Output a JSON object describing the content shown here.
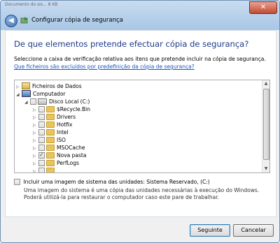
{
  "window": {
    "corner_text": "Documento do sis... 8 KB",
    "title": "Configurar cópia de segurança",
    "close_label": "✕"
  },
  "heading": "De que elementos pretende efectuar cópia de segurança?",
  "instructions": {
    "text": "Seleccione a caixa de verificação relativa aos itens que pretende incluir na cópia de segurança.",
    "link": "Que ficheiros são excluídos por predefinição da cópia de segurança?"
  },
  "tree": {
    "items": [
      {
        "label": "Ficheiros de Dados",
        "icon": "library-icon",
        "checked": false,
        "expander": "▷"
      },
      {
        "label": "Computador",
        "icon": "computer-icon",
        "checked": false,
        "expander": "◢"
      },
      {
        "label": "Disco Local (C:)",
        "icon": "drive-icon",
        "checked": false,
        "expander": "◢"
      },
      {
        "label": "$Recycle.Bin",
        "icon": "folder-icon",
        "checked": false,
        "expander": "▷"
      },
      {
        "label": "Drivers",
        "icon": "folder-icon",
        "checked": false,
        "expander": "▷"
      },
      {
        "label": "Hotfix",
        "icon": "folder-icon",
        "checked": false,
        "expander": "▷"
      },
      {
        "label": "Intel",
        "icon": "folder-icon",
        "checked": false,
        "expander": "▷"
      },
      {
        "label": "ISO",
        "icon": "folder-icon",
        "checked": false,
        "expander": "▷"
      },
      {
        "label": "MSOCache",
        "icon": "folder-icon",
        "checked": false,
        "expander": "▷"
      },
      {
        "label": "Nova pasta",
        "icon": "folder-icon",
        "checked": true,
        "expander": "▷"
      },
      {
        "label": "PerfLogs",
        "icon": "folder-icon",
        "checked": false,
        "expander": "▷"
      },
      {
        "label": "",
        "icon": "folder-icon",
        "checked": false,
        "expander": "▷"
      }
    ]
  },
  "system_image": {
    "checkbox_label": "Incluir uma imagem de sistema das unidades: Sistema Reservado, (C:)",
    "checked": false,
    "description": "Uma imagem do sistema é uma cópia das unidades necessárias à execução do Windows. Poderá utilizá-la para restaurar o computador caso este pare de trabalhar."
  },
  "buttons": {
    "next": "Seguinte",
    "cancel": "Cancelar"
  }
}
